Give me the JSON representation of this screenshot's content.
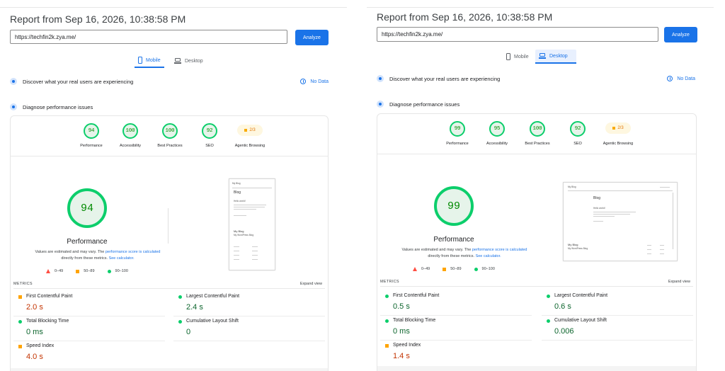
{
  "reports": [
    {
      "title": "Report from Sep 16, 2026, 10:38:58 PM",
      "url": "https://techfin2k.zya.me/",
      "analyze_label": "Analyze",
      "tabs": {
        "mobile": "Mobile",
        "desktop": "Desktop",
        "active": "mobile"
      },
      "crux": {
        "label": "Discover what your real users are experiencing",
        "no_data": "No Data"
      },
      "diagnose_label": "Diagnose performance issues",
      "scores": [
        {
          "label": "Performance",
          "value": "94"
        },
        {
          "label": "Accessibility",
          "value": "100"
        },
        {
          "label": "Best Practices",
          "value": "100"
        },
        {
          "label": "SEO",
          "value": "92"
        },
        {
          "label": "Agentic Browsing",
          "value": "2/3"
        }
      ],
      "main_score": "94",
      "main_title": "Performance",
      "note_prefix": "Values are estimated and may vary. The ",
      "note_link1": "performance score is calculated",
      "note_mid": " directly from these metrics. ",
      "note_link2": "See calculator.",
      "legend": [
        "0–49",
        "50–89",
        "90–100"
      ],
      "metrics_label": "METRICS",
      "expand_label": "Expand view",
      "metrics": [
        {
          "name": "First Contentful Paint",
          "value": "2.0 s",
          "status": "average"
        },
        {
          "name": "Largest Contentful Paint",
          "value": "2.4 s",
          "status": "good"
        },
        {
          "name": "Total Blocking Time",
          "value": "0 ms",
          "status": "good"
        },
        {
          "name": "Cumulative Layout Shift",
          "value": "0",
          "status": "good"
        },
        {
          "name": "Speed Index",
          "value": "4.0 s",
          "status": "average"
        }
      ],
      "thumb": {
        "site": "My Blog",
        "heading": "Blog",
        "post_title": "Hello world!",
        "blog_title": "My Blog",
        "tagline": "My WordPress Blog"
      }
    },
    {
      "title": "Report from Sep 16, 2026, 10:38:58 PM",
      "url": "https://techfin2k.zya.me/",
      "analyze_label": "Analyze",
      "tabs": {
        "mobile": "Mobile",
        "desktop": "Desktop",
        "active": "desktop"
      },
      "crux": {
        "label": "Discover what your real users are experiencing",
        "no_data": "No Data"
      },
      "diagnose_label": "Diagnose performance issues",
      "scores": [
        {
          "label": "Performance",
          "value": "99"
        },
        {
          "label": "Accessibility",
          "value": "95"
        },
        {
          "label": "Best Practices",
          "value": "100"
        },
        {
          "label": "SEO",
          "value": "92"
        },
        {
          "label": "Agentic Browsing",
          "value": "2/3"
        }
      ],
      "main_score": "99",
      "main_title": "Performance",
      "note_prefix": "Values are estimated and may vary. The ",
      "note_link1": "performance score is calculated",
      "note_mid": " directly from these metrics. ",
      "note_link2": "See calculator.",
      "legend": [
        "0–49",
        "50–89",
        "90–100"
      ],
      "metrics_label": "METRICS",
      "expand_label": "Expand view",
      "metrics": [
        {
          "name": "First Contentful Paint",
          "value": "0.5 s",
          "status": "good"
        },
        {
          "name": "Largest Contentful Paint",
          "value": "0.6 s",
          "status": "good"
        },
        {
          "name": "Total Blocking Time",
          "value": "0 ms",
          "status": "good"
        },
        {
          "name": "Cumulative Layout Shift",
          "value": "0.006",
          "status": "good"
        },
        {
          "name": "Speed Index",
          "value": "1.4 s",
          "status": "average"
        }
      ],
      "thumb": {
        "site": "My Blog",
        "heading": "Blog",
        "post_title": "Hello world!",
        "blog_title": "My Blog",
        "tagline": "My WordPress Blog"
      }
    }
  ],
  "colors": {
    "good": "#0cce6b",
    "average": "#ffa400",
    "poor": "#ff4e42",
    "accent": "#1a73e8"
  }
}
